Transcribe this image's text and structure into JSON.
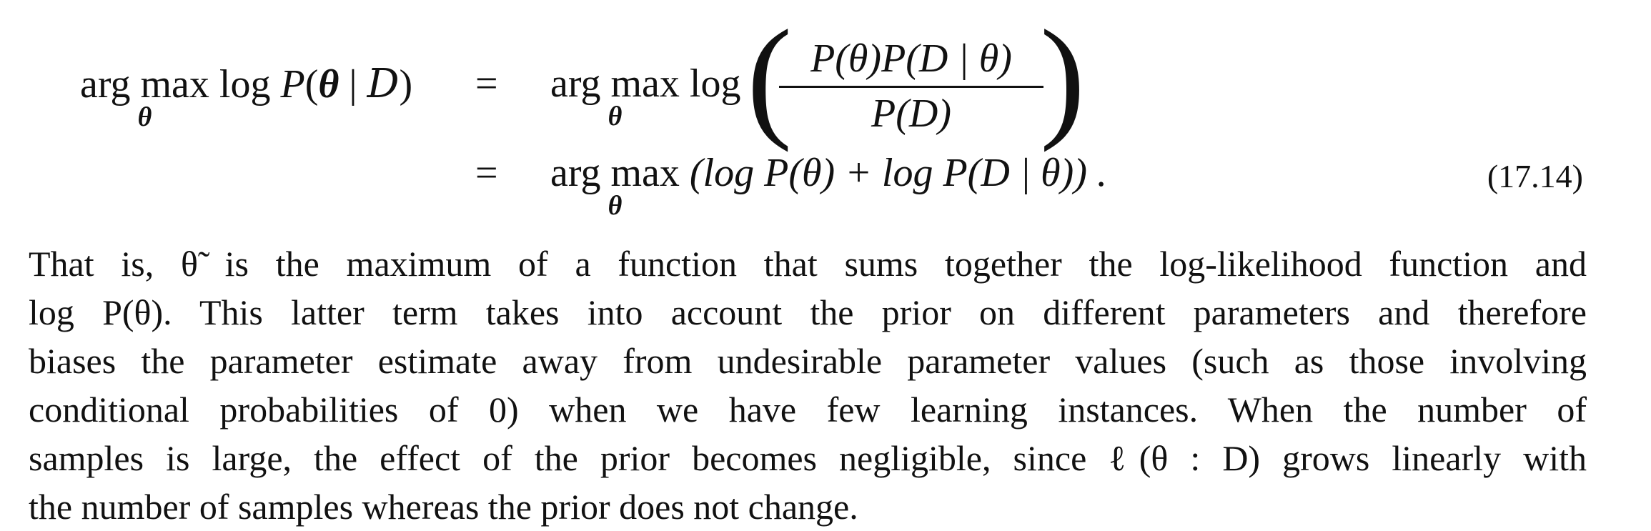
{
  "equation": {
    "lhs_op": "arg max",
    "sub": "θ",
    "lhs_log": "log",
    "lhs_expr_p": "P",
    "lhs_expr_open": "(",
    "lhs_theta": "θ",
    "lhs_bar": " | ",
    "lhs_D": "D",
    "lhs_close": ")",
    "equals": "=",
    "rhs1_op": "arg max",
    "rhs1_log": "log",
    "frac_num": "P(θ)P(D | θ)",
    "frac_den": "P(D)",
    "rhs2_op": "arg max",
    "rhs2_body": "(log P(θ) + log P(D | θ)) .",
    "number": "(17.14)"
  },
  "paragraph": {
    "lines": [
      "That is, θ̃ is the maximum of a function that sums together the log-likelihood function and",
      "log P(θ).  This latter term takes into account the prior on different parameters and therefore",
      "biases the parameter estimate away from undesirable parameter values (such as those involving",
      "conditional probabilities of 0) when we have few learning instances.  When the number of",
      "samples is large, the effect of the prior becomes negligible, since ℓ(θ : D) grows linearly with",
      "the number of samples whereas the prior does not change."
    ]
  }
}
